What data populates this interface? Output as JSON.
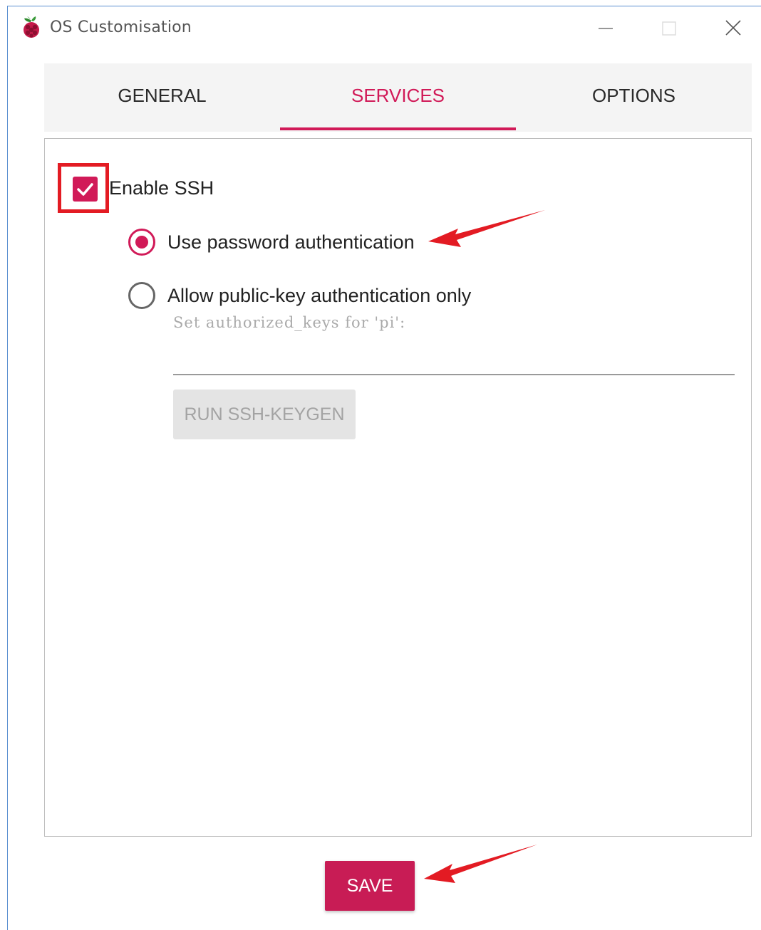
{
  "window": {
    "title": "OS Customisation",
    "icon": "raspberry-pi-icon"
  },
  "tabs": [
    {
      "label": "GENERAL",
      "active": false
    },
    {
      "label": "SERVICES",
      "active": true
    },
    {
      "label": "OPTIONS",
      "active": false
    }
  ],
  "ssh": {
    "enable_label": "Enable SSH",
    "enabled": true,
    "auth_options": [
      {
        "label": "Use password authentication",
        "selected": true
      },
      {
        "label": "Allow public-key authentication only",
        "selected": false
      }
    ],
    "authorized_keys_label": "Set authorized_keys for 'pi':",
    "authorized_keys_value": "",
    "keygen_label": "RUN SSH-KEYGEN"
  },
  "footer": {
    "save_label": "SAVE"
  },
  "colors": {
    "accent": "#d11a58",
    "save_button": "#c81c55",
    "annotation_red": "#e31b23"
  }
}
